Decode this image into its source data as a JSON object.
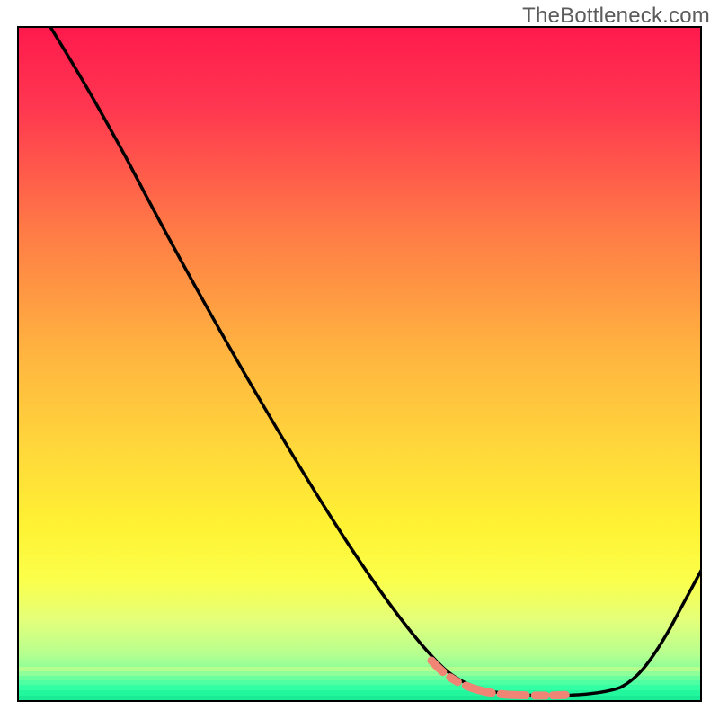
{
  "watermark": "TheBottleneck.com",
  "chart_data": {
    "type": "line",
    "title": "",
    "xlabel": "",
    "ylabel": "",
    "xlim": [
      0,
      100
    ],
    "ylim": [
      0,
      100
    ],
    "grid": false,
    "legend": false,
    "background_gradient": {
      "top_color": "#ff1a4d",
      "mid_color": "#fff233",
      "bottom_color": "#27ffa3"
    },
    "series": [
      {
        "name": "bottleneck_curve",
        "color": "#000000",
        "x": [
          5,
          10,
          16,
          24,
          32,
          42,
          52,
          60,
          66,
          72,
          78,
          84,
          88,
          92,
          96,
          100
        ],
        "values": [
          100,
          92,
          80,
          66,
          52,
          37,
          24,
          14,
          7,
          2,
          0,
          0,
          1,
          5,
          12,
          19
        ]
      }
    ],
    "optimal_range_marker": {
      "color": "#f08575",
      "style": "dashed",
      "x_start": 60,
      "x_end": 91,
      "y_approx": 0
    }
  }
}
